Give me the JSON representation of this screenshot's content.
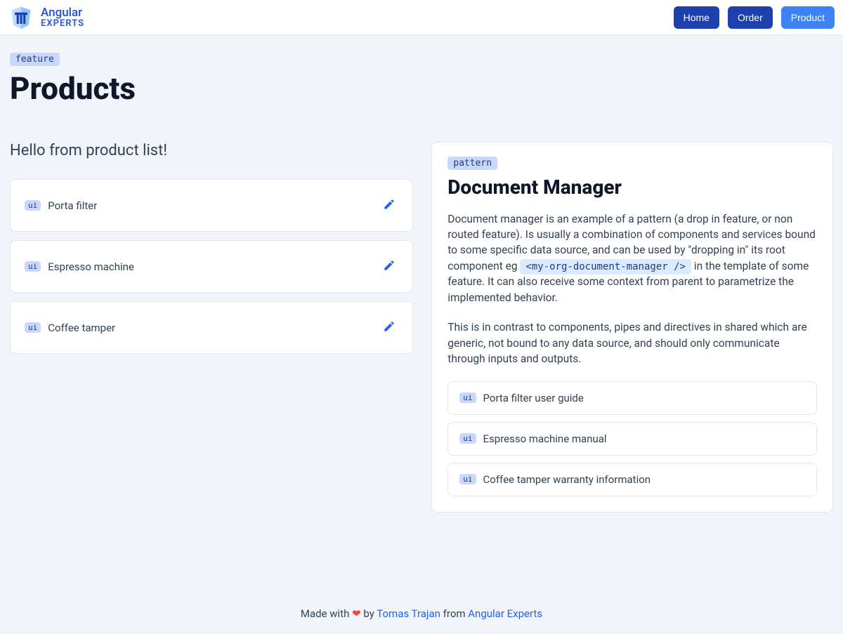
{
  "header": {
    "logo_line1": "Angular",
    "logo_line2": "EXPERTS",
    "nav": [
      {
        "label": "Home",
        "active": false
      },
      {
        "label": "Order",
        "active": false
      },
      {
        "label": "Product",
        "active": true
      }
    ]
  },
  "page": {
    "badge": "feature",
    "title": "Products"
  },
  "product_list": {
    "hello": "Hello from product list!",
    "ui_badge": "ui",
    "items": [
      {
        "name": "Porta filter"
      },
      {
        "name": "Espresso machine"
      },
      {
        "name": "Coffee tamper"
      }
    ]
  },
  "panel": {
    "badge": "pattern",
    "title": "Document Manager",
    "p1a": "Document manager is an example of a pattern (a drop in feature, or non routed feature). Is usually a combination of components and services bound to some specific data source, and can be used by \"dropping in\" its root component eg ",
    "code": "<my-org-document-manager />",
    "p1b": " in the template of some feature. It can also receive some context from parent to parametrize the implemented behavior.",
    "p2": "This is in contrast to components, pipes and directives in shared which are generic, not bound to any data source, and should only communicate through inputs and outputs.",
    "ui_badge": "ui",
    "docs": [
      {
        "name": "Porta filter user guide"
      },
      {
        "name": "Espresso machine manual"
      },
      {
        "name": "Coffee tamper warranty information"
      }
    ]
  },
  "footer": {
    "made_with": "Made with ",
    "heart": "❤",
    "by": " by ",
    "author": "Tomas Trajan",
    "from": " from ",
    "org": "Angular Experts"
  }
}
